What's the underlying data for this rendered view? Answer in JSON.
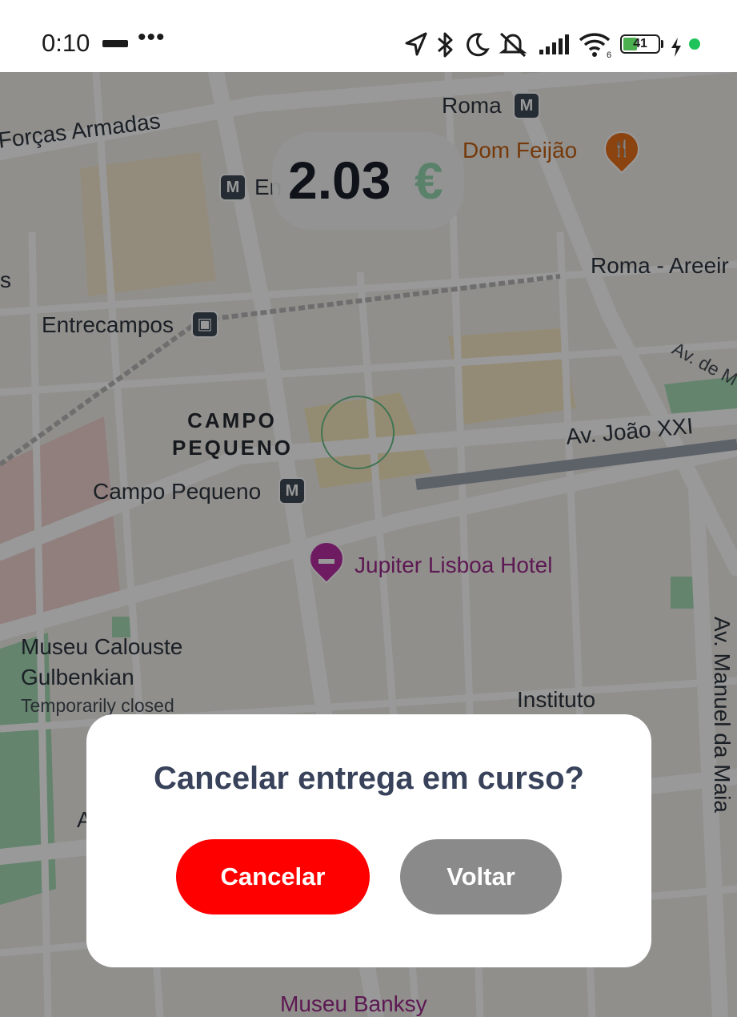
{
  "status_bar": {
    "time": "0:10",
    "battery_level": "41",
    "battery_percent": 41,
    "icons": [
      "navigation-icon",
      "bluetooth-icon",
      "moon-icon",
      "mute-icon",
      "signal-icon",
      "wifi-icon",
      "battery-icon",
      "charging-icon"
    ],
    "wifi_sub": "6"
  },
  "price": {
    "value": "2.03",
    "currency": "€"
  },
  "map": {
    "labels": {
      "roma": "Roma",
      "forcas_armadas": "Forças Armadas",
      "dom_feijao": "Dom Feijão",
      "entrecampos_station": "En",
      "roma_areeiro": "Roma - Areeir",
      "entrecampos": "Entrecampos",
      "s_edge": "s",
      "av_de": "Av. de M",
      "campo_pequeno_district_1": "CAMPO",
      "campo_pequeno_district_2": "PEQUENO",
      "av_joao_xxi": "Av. João XXI",
      "campo_pequeno": "Campo Pequeno",
      "jupiter": "Jupiter Lisboa Hotel",
      "museu_1": "Museu Calouste",
      "museu_2": "Gulbenkian",
      "temporarily_closed": "Temporarily closed",
      "instituto": "Instituto",
      "av_manuel": "Av. Manuel da Maia",
      "museu_banksy": "Museu Banksy",
      "a_letter": "A"
    },
    "metro_glyph": "M"
  },
  "dialog": {
    "title": "Cancelar entrega em curso?",
    "cancel_label": "Cancelar",
    "back_label": "Voltar"
  },
  "colors": {
    "cancel": "#ff0000",
    "back": "#8a8a8a",
    "title": "#38425a",
    "currency": "#4cbf7a"
  }
}
